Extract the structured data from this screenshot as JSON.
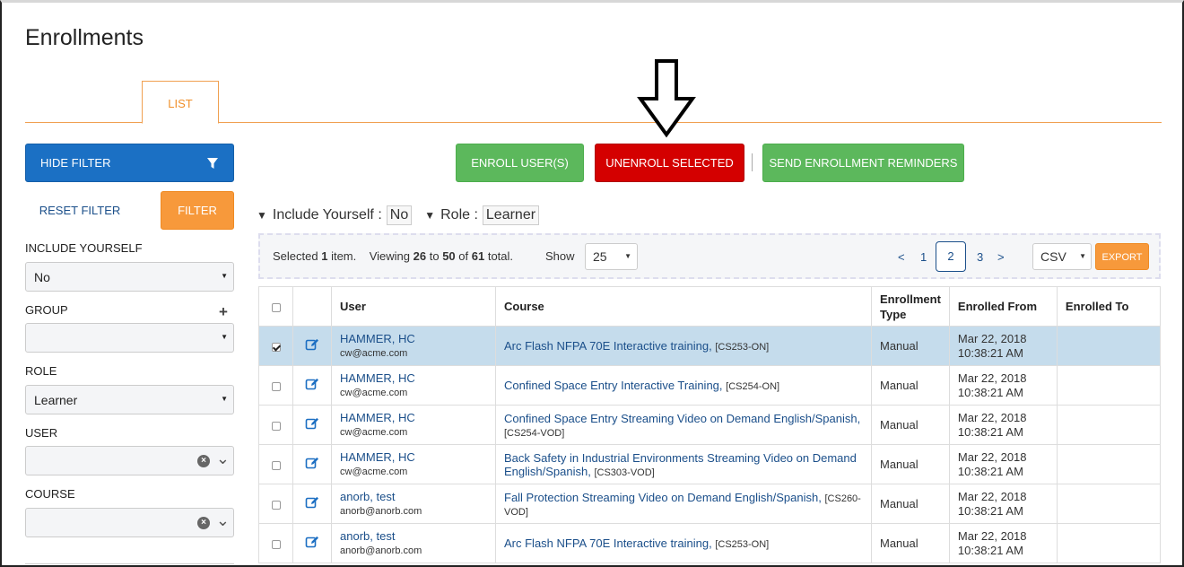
{
  "page": {
    "title": "Enrollments"
  },
  "tabs": [
    {
      "label": "LIST"
    }
  ],
  "sidebar": {
    "hide_filter_label": "HIDE FILTER",
    "reset_filter_label": "RESET FILTER",
    "filter_label": "FILTER",
    "fields": {
      "include_yourself": {
        "label": "INCLUDE YOURSELF",
        "value": "No"
      },
      "group": {
        "label": "GROUP",
        "value": ""
      },
      "role": {
        "label": "ROLE",
        "value": "Learner"
      },
      "user": {
        "label": "USER",
        "value": ""
      },
      "course": {
        "label": "COURSE",
        "value": ""
      }
    }
  },
  "actions": {
    "enroll_label": "ENROLL USER(S)",
    "unenroll_label": "UNENROLL SELECTED",
    "reminders_label": "SEND ENROLLMENT REMINDERS"
  },
  "active_filters": [
    {
      "label": "Include Yourself :",
      "value": "No"
    },
    {
      "label": "Role :",
      "value": "Learner"
    }
  ],
  "info": {
    "selected_prefix": "Selected",
    "selected_count": "1",
    "selected_suffix": "item.",
    "viewing_prefix": "Viewing",
    "from": "26",
    "to_word": "to",
    "to": "50",
    "of_word": "of",
    "total": "61",
    "total_suffix": "total.",
    "show_label": "Show",
    "page_size": "25"
  },
  "pagination": {
    "prev": "<",
    "pages": [
      "1",
      "2",
      "3"
    ],
    "current": "2",
    "next": ">"
  },
  "export": {
    "format": "CSV",
    "label": "EXPORT"
  },
  "table": {
    "columns": [
      "User",
      "Course",
      "Enrollment Type",
      "Enrolled From",
      "Enrolled To"
    ],
    "enrollment_type_line1": "Enrollment",
    "enrollment_type_line2": "Type",
    "rows": [
      {
        "selected": true,
        "user": "HAMMER, HC",
        "email": "cw@acme.com",
        "course": "Arc Flash NFPA 70E Interactive training,",
        "code": "[CS253-ON]",
        "type": "Manual",
        "from_date": "Mar 22, 2018",
        "from_time": "10:38:21 AM",
        "to": ""
      },
      {
        "selected": false,
        "user": "HAMMER, HC",
        "email": "cw@acme.com",
        "course": "Confined Space Entry Interactive Training,",
        "code": "[CS254-ON]",
        "type": "Manual",
        "from_date": "Mar 22, 2018",
        "from_time": "10:38:21 AM",
        "to": ""
      },
      {
        "selected": false,
        "user": "HAMMER, HC",
        "email": "cw@acme.com",
        "course": "Confined Space Entry Streaming Video on Demand English/Spanish,",
        "code": "[CS254-VOD]",
        "type": "Manual",
        "from_date": "Mar 22, 2018",
        "from_time": "10:38:21 AM",
        "to": ""
      },
      {
        "selected": false,
        "user": "HAMMER, HC",
        "email": "cw@acme.com",
        "course": "Back Safety in Industrial Environments Streaming Video on Demand English/Spanish,",
        "code": "[CS303-VOD]",
        "type": "Manual",
        "from_date": "Mar 22, 2018",
        "from_time": "10:38:21 AM",
        "to": ""
      },
      {
        "selected": false,
        "user": "anorb, test",
        "email": "anorb@anorb.com",
        "course": "Fall Protection Streaming Video on Demand English/Spanish,",
        "code": "[CS260-VOD]",
        "type": "Manual",
        "from_date": "Mar 22, 2018",
        "from_time": "10:38:21 AM",
        "to": ""
      },
      {
        "selected": false,
        "user": "anorb, test",
        "email": "anorb@anorb.com",
        "course": "Arc Flash NFPA 70E Interactive training,",
        "code": "[CS253-ON]",
        "type": "Manual",
        "from_date": "Mar 22, 2018",
        "from_time": "10:38:21 AM",
        "to": ""
      }
    ]
  }
}
